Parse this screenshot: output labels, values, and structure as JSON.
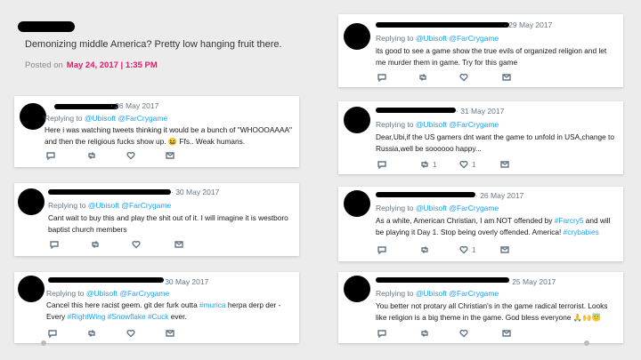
{
  "top_post": {
    "text": "Demonizing middle America? Pretty low hanging fruit there.",
    "posted_label": "Posted  on",
    "posted_date": "May 24, 2017 | 1:35 PM"
  },
  "reply_prefix": "Replying to",
  "reply_handles": "@Ubisoft @FarCrygame",
  "tweets": [
    {
      "date": "· 26 May 2017",
      "text": "Here i was watching tweets thinking it would be a bunch of \"WHOOOAAAA\" and then the religious fucks show up. 😆 Ffs.. Weak humans.",
      "retweets": "",
      "likes": ""
    },
    {
      "date": "· 30 May 2017",
      "text": "Cant wait to buy this and play the shit out of it. I will imagine it is westboro baptist church members",
      "retweets": "",
      "likes": ""
    },
    {
      "date": "· 30 May 2017",
      "text_a": "Cancel this here racist geem. git der furk outta ",
      "tag1": "#murica",
      "text_b": " herpa derp der - Every ",
      "tag2": "#RightWing",
      "tag3": "#Snowflake",
      "tag4": "#Cuck",
      "text_c": " ever.",
      "retweets": "",
      "likes": ""
    },
    {
      "date": "· 29 May 2017",
      "text": "its good to see a game show the true evils of organized religion and let me murder them in game. Try for this game",
      "retweets": "",
      "likes": ""
    },
    {
      "date": "· 31 May 2017",
      "text": "Dear,Ubi,if the US gamers dnt want the game to unfold in USA,change to Russia,well be soooooo happy...",
      "retweets": "1",
      "likes": "1"
    },
    {
      "date": "· 26 May 2017",
      "text_a": "As a white, American Christian, I am NOT offended by ",
      "tag1": "#Farcry5",
      "text_b": " and will be playing it Day 1.  Stop being overly offended. America! ",
      "tag2": "#crybabies",
      "retweets": "",
      "likes": "1"
    },
    {
      "date": "· 25 May 2017",
      "text": "You better not protary all Christian's in the game radical terrorist. Looks like religion is a big theme in the game. God bless everyone 🙏🙌😇",
      "retweets": "",
      "likes": ""
    }
  ],
  "icons": [
    "reply-icon",
    "retweet-icon",
    "heart-icon",
    "mail-icon"
  ]
}
